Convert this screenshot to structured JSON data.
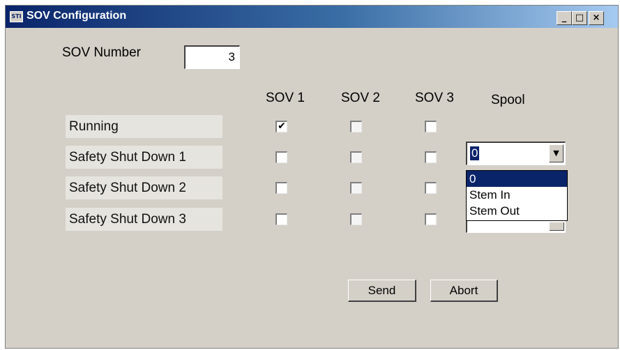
{
  "window": {
    "title": "SOV Configuration",
    "icon_text": "STI",
    "controls": {
      "minimize": "_",
      "maximize": "□",
      "close": "×"
    }
  },
  "sov_number": {
    "label": "SOV Number",
    "value": "3"
  },
  "columns": [
    "SOV 1",
    "SOV 2",
    "SOV 3",
    "Spool"
  ],
  "rows": [
    {
      "label": "Running",
      "checks": [
        true,
        false,
        false
      ]
    },
    {
      "label": "Safety Shut Down 1",
      "checks": [
        false,
        false,
        false
      ]
    },
    {
      "label": "Safety Shut Down 2",
      "checks": [
        false,
        false,
        false
      ]
    },
    {
      "label": "Safety Shut Down 3",
      "checks": [
        false,
        false,
        false
      ]
    }
  ],
  "check_glyph": "✔",
  "spool": {
    "selected": "0",
    "arrow_icon": "▼",
    "options": [
      "0",
      "Stem In",
      "Stem Out"
    ]
  },
  "buttons": {
    "send": "Send",
    "abort": "Abort"
  }
}
